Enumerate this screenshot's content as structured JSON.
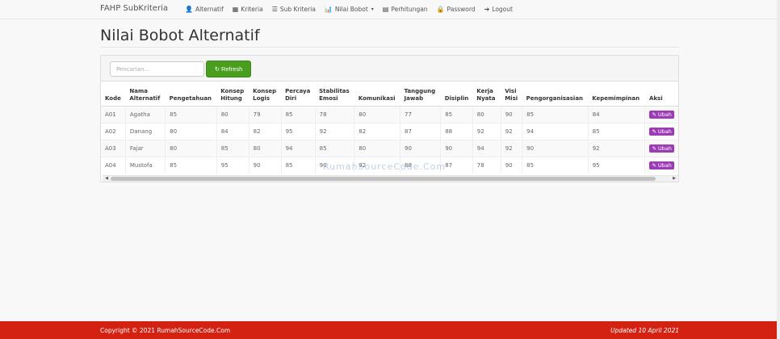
{
  "brand": "FAHP SubKriteria",
  "nav": [
    {
      "label": "Alternatif",
      "icon": "👤"
    },
    {
      "label": "Kriteria",
      "icon": "▦"
    },
    {
      "label": "Sub Kriteria",
      "icon": "☰"
    },
    {
      "label": "Nilai Bobot",
      "icon": "📊"
    },
    {
      "label": "Perhitungan",
      "icon": "▤"
    },
    {
      "label": "Password",
      "icon": "🔒"
    },
    {
      "label": "Logout",
      "icon": "➔"
    }
  ],
  "nav_dropdown_caret": "▾",
  "page_title": "Nilai Bobot Alternatif",
  "search": {
    "placeholder": "Pencarian...",
    "value": ""
  },
  "refresh_label": "Refresh",
  "refresh_icon": "↻",
  "table": {
    "headers": [
      "Kode",
      "Nama Alternatif",
      "Pengetahuan",
      "Konsep Hitung",
      "Konsep Logis",
      "Percaya Diri",
      "Stabilitas Emosi",
      "Komunikasi",
      "Tanggung Jawab",
      "Disiplin",
      "Kerja Nyata",
      "Visi Misi",
      "Pengorganisasian",
      "Kepemimpinan",
      "Aksi"
    ],
    "rows": [
      [
        "A01",
        "Agatha",
        "85",
        "80",
        "79",
        "85",
        "78",
        "80",
        "77",
        "85",
        "80",
        "90",
        "85",
        "84"
      ],
      [
        "A02",
        "Danang",
        "80",
        "84",
        "82",
        "95",
        "92",
        "82",
        "87",
        "88",
        "92",
        "92",
        "94",
        "85"
      ],
      [
        "A03",
        "Fajar",
        "80",
        "85",
        "80",
        "94",
        "85",
        "80",
        "90",
        "90",
        "94",
        "92",
        "90",
        "92"
      ],
      [
        "A04",
        "Mustofa",
        "85",
        "95",
        "90",
        "85",
        "90",
        "92",
        "88",
        "87",
        "78",
        "90",
        "85",
        "95"
      ]
    ],
    "action_label": "Ubah",
    "action_icon": "✎"
  },
  "watermark": "RumahSourceCode.Com",
  "footer": {
    "copyright": "Copyright © 2021 RumahSourceCode.Com",
    "updated": "Updated 10 April 2021"
  },
  "colors": {
    "footer": "#d42212",
    "refresh_button": "#4a9e1f",
    "action_button": "#9b3bb5"
  }
}
